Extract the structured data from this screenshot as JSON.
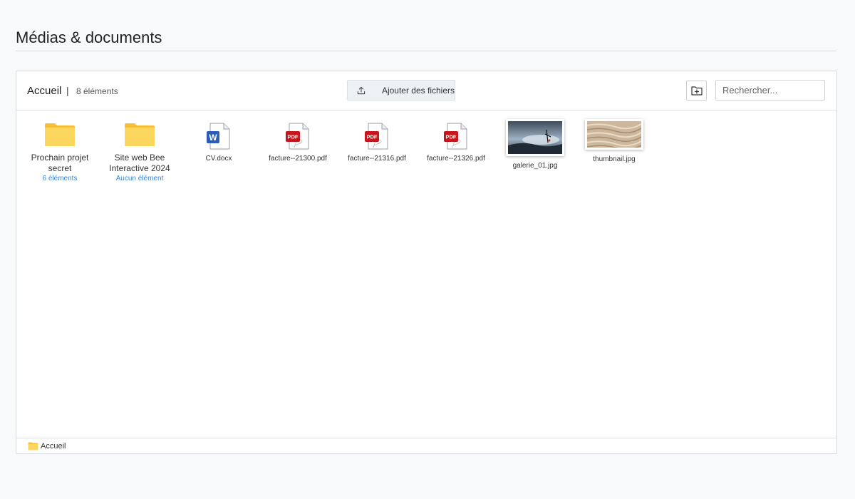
{
  "page": {
    "title": "Médias & documents"
  },
  "toolbar": {
    "current_folder": "Accueil",
    "separator": "|",
    "item_count": "8 éléments",
    "upload_label": "Ajouter des fichiers",
    "search_placeholder": "Rechercher..."
  },
  "items": [
    {
      "type": "folder",
      "name": "Prochain projet secret",
      "sub": "6 éléments"
    },
    {
      "type": "folder",
      "name": "Site web Bee Interactive 2024",
      "sub": "Aucun élément"
    },
    {
      "type": "docx",
      "name": "CV.docx",
      "badge": "W"
    },
    {
      "type": "pdf",
      "name": "facture--21300.pdf",
      "badge": "PDF"
    },
    {
      "type": "pdf",
      "name": "facture--21316.pdf",
      "badge": "PDF"
    },
    {
      "type": "pdf",
      "name": "facture--21326.pdf",
      "badge": "PDF"
    },
    {
      "type": "image",
      "name": "galerie_01.jpg"
    },
    {
      "type": "image",
      "name": "thumbnail.jpg"
    }
  ],
  "footer": {
    "breadcrumb_label": "Accueil"
  },
  "colors": {
    "folder": "#fcd75f",
    "link_blue": "#3a87d6",
    "pdf_red": "#c8161d",
    "word_blue": "#2b5cb8"
  }
}
